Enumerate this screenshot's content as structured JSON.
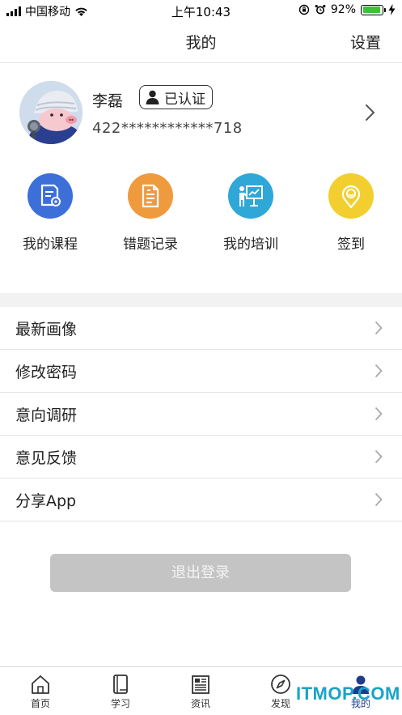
{
  "status_bar": {
    "carrier": "中国移动",
    "time": "上午10:43",
    "battery_percent": "92%",
    "battery_level": 0.92,
    "icons": [
      "signal-icon",
      "wifi-icon",
      "rotation-lock-icon",
      "alarm-icon",
      "battery-icon",
      "charging-icon"
    ]
  },
  "header": {
    "title": "我的",
    "settings_label": "设置"
  },
  "profile": {
    "name": "李磊",
    "badge": "已认证",
    "id_number": "422************718"
  },
  "quick_actions": [
    {
      "label": "我的课程",
      "icon": "course-document-icon",
      "color": "#3d6fd9"
    },
    {
      "label": "错题记录",
      "icon": "mistake-record-icon",
      "color": "#f09a3e"
    },
    {
      "label": "我的培训",
      "icon": "training-presentation-icon",
      "color": "#2fa8d8"
    },
    {
      "label": "签到",
      "icon": "check-in-location-icon",
      "color": "#f2cf2e"
    }
  ],
  "menu": [
    {
      "label": "最新画像"
    },
    {
      "label": "修改密码"
    },
    {
      "label": "意向调研"
    },
    {
      "label": "意见反馈"
    },
    {
      "label": "分享App"
    }
  ],
  "logout_label": "退出登录",
  "tabs": [
    {
      "label": "首页",
      "icon": "home-icon"
    },
    {
      "label": "学习",
      "icon": "book-icon"
    },
    {
      "label": "资讯",
      "icon": "news-icon"
    },
    {
      "label": "发现",
      "icon": "compass-icon"
    },
    {
      "label": "我的",
      "icon": "profile-icon",
      "active": true
    }
  ],
  "watermark": "ITMOP.COM",
  "colors": {
    "accent": "#1f3c88",
    "logout_disabled": "#c4c4c4",
    "divider": "#f2f2f2",
    "battery": "#3cc13b"
  }
}
